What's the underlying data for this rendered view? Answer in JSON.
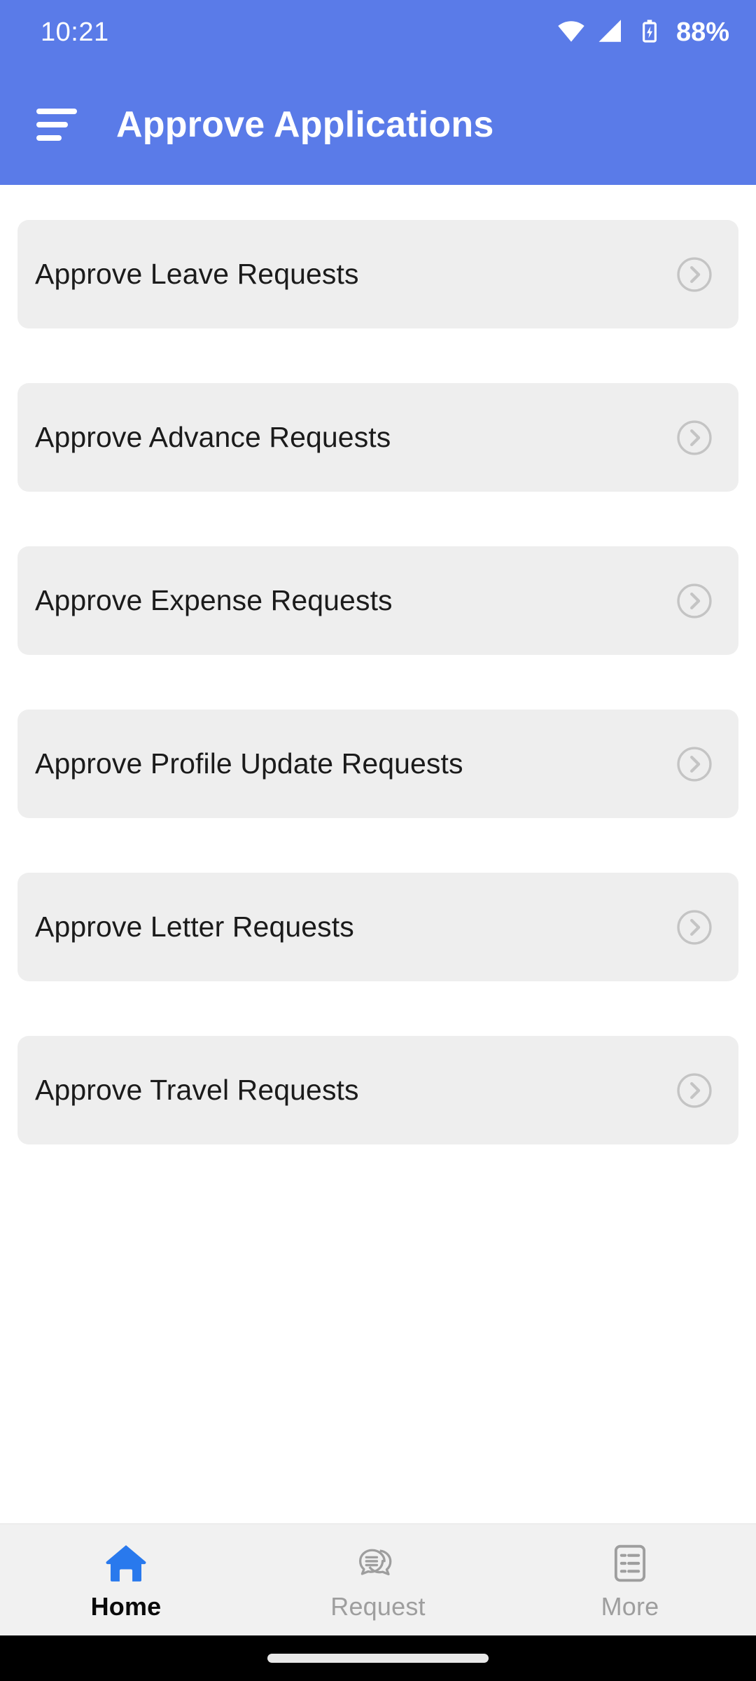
{
  "theme": {
    "accent": "#5A7BE8",
    "nav_active_icon": "#2979ED",
    "card_bg": "#EEEEEE",
    "bottom_nav_bg": "#F1F1F1",
    "gesture_bar_bg": "#000000"
  },
  "status_bar": {
    "time": "10:21",
    "battery_percent": "88%",
    "icons": [
      "wifi-icon",
      "cellular-signal-icon",
      "battery-charging-icon"
    ]
  },
  "app_bar": {
    "menu_icon": "hamburger-menu-icon",
    "title": "Approve Applications"
  },
  "main": {
    "items": [
      {
        "label": "Approve Leave Requests",
        "chevron": "chevron-right-circle-icon"
      },
      {
        "label": "Approve Advance Requests",
        "chevron": "chevron-right-circle-icon"
      },
      {
        "label": "Approve Expense Requests",
        "chevron": "chevron-right-circle-icon"
      },
      {
        "label": "Approve Profile Update Requests",
        "chevron": "chevron-right-circle-icon"
      },
      {
        "label": "Approve Letter Requests",
        "chevron": "chevron-right-circle-icon"
      },
      {
        "label": "Approve Travel Requests",
        "chevron": "chevron-right-circle-icon"
      }
    ]
  },
  "bottom_nav": {
    "items": [
      {
        "label": "Home",
        "icon": "home-icon",
        "active": true
      },
      {
        "label": "Request",
        "icon": "chat-bubbles-icon",
        "active": false
      },
      {
        "label": "More",
        "icon": "list-document-icon",
        "active": false
      }
    ]
  }
}
